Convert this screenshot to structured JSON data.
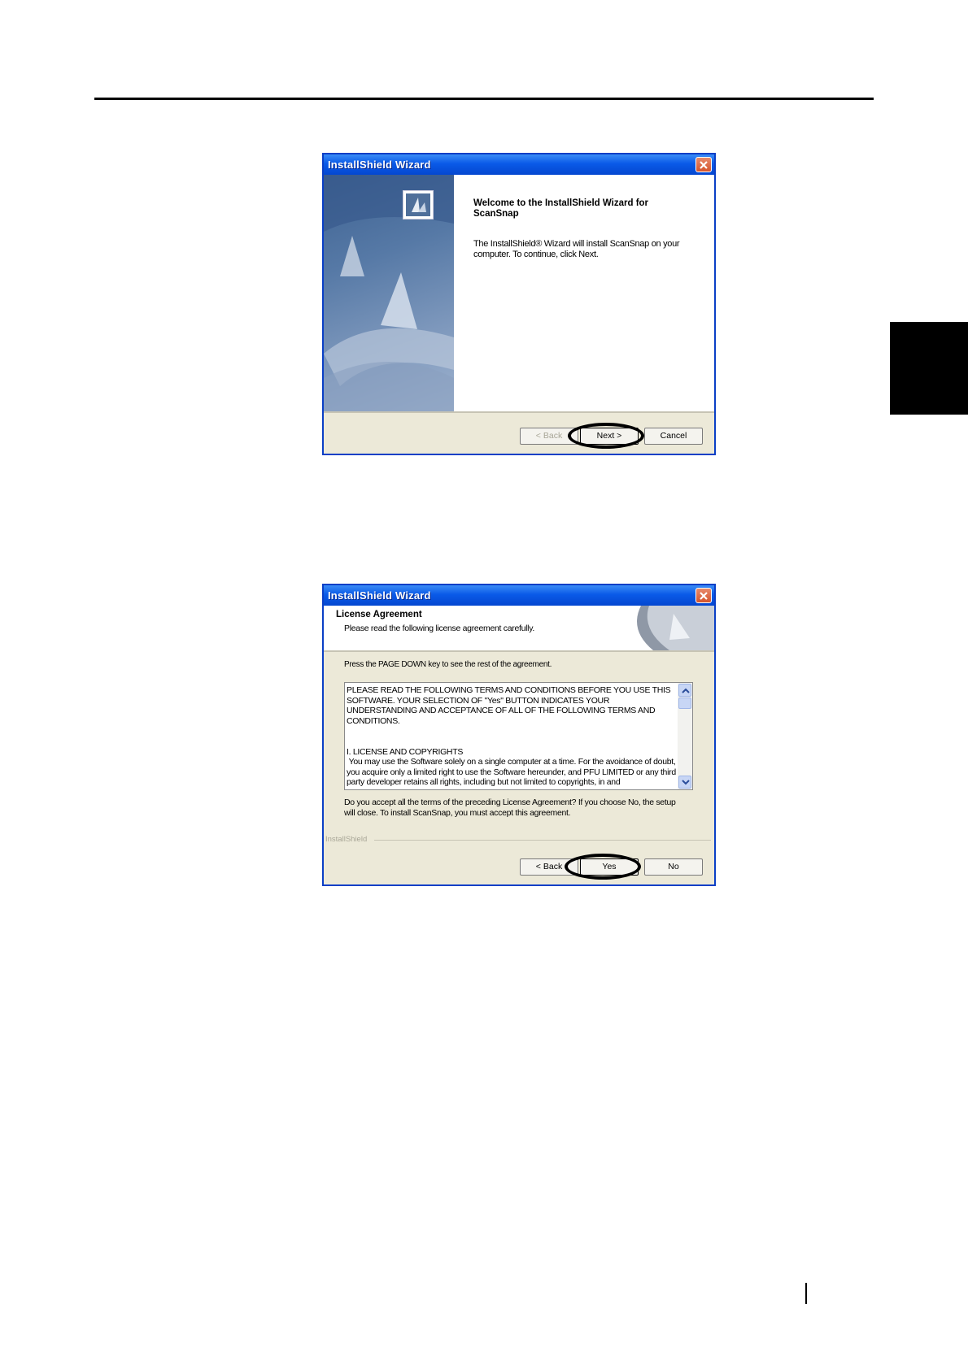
{
  "dialog_welcome": {
    "title": "InstallShield Wizard",
    "heading": "Welcome to the InstallShield Wizard for ScanSnap",
    "body": "The InstallShield® Wizard will install ScanSnap on your computer.  To continue, click Next.",
    "buttons": {
      "back": "< Back",
      "next": "Next >",
      "cancel": "Cancel"
    }
  },
  "dialog_license": {
    "title": "InstallShield Wizard",
    "header_title": "License Agreement",
    "header_subtitle": "Please read the following license agreement carefully.",
    "instruction": "Press the PAGE DOWN key to see the rest of the agreement.",
    "license_text": "PLEASE READ THE FOLLOWING TERMS AND CONDITIONS BEFORE YOU USE THIS SOFTWARE. YOUR SELECTION OF \"Yes\" BUTTON INDICATES YOUR UNDERSTANDING AND ACCEPTANCE OF ALL OF THE FOLLOWING TERMS AND CONDITIONS.\n\n\nI. LICENSE AND COPYRIGHTS\n You may use the Software solely on a single computer at a time. For the avoidance of doubt, you acquire only a limited right to use the Software hereunder, and PFU LIMITED or any third party developer retains all rights, including but not limited to copyrights, in and",
    "question": "Do you accept all the terms of the preceding License Agreement?  If you choose No,  the setup will close.  To install ScanSnap, you must accept this agreement.",
    "brand": "InstallShield",
    "buttons": {
      "back": "< Back",
      "yes": "Yes",
      "no": "No"
    }
  }
}
